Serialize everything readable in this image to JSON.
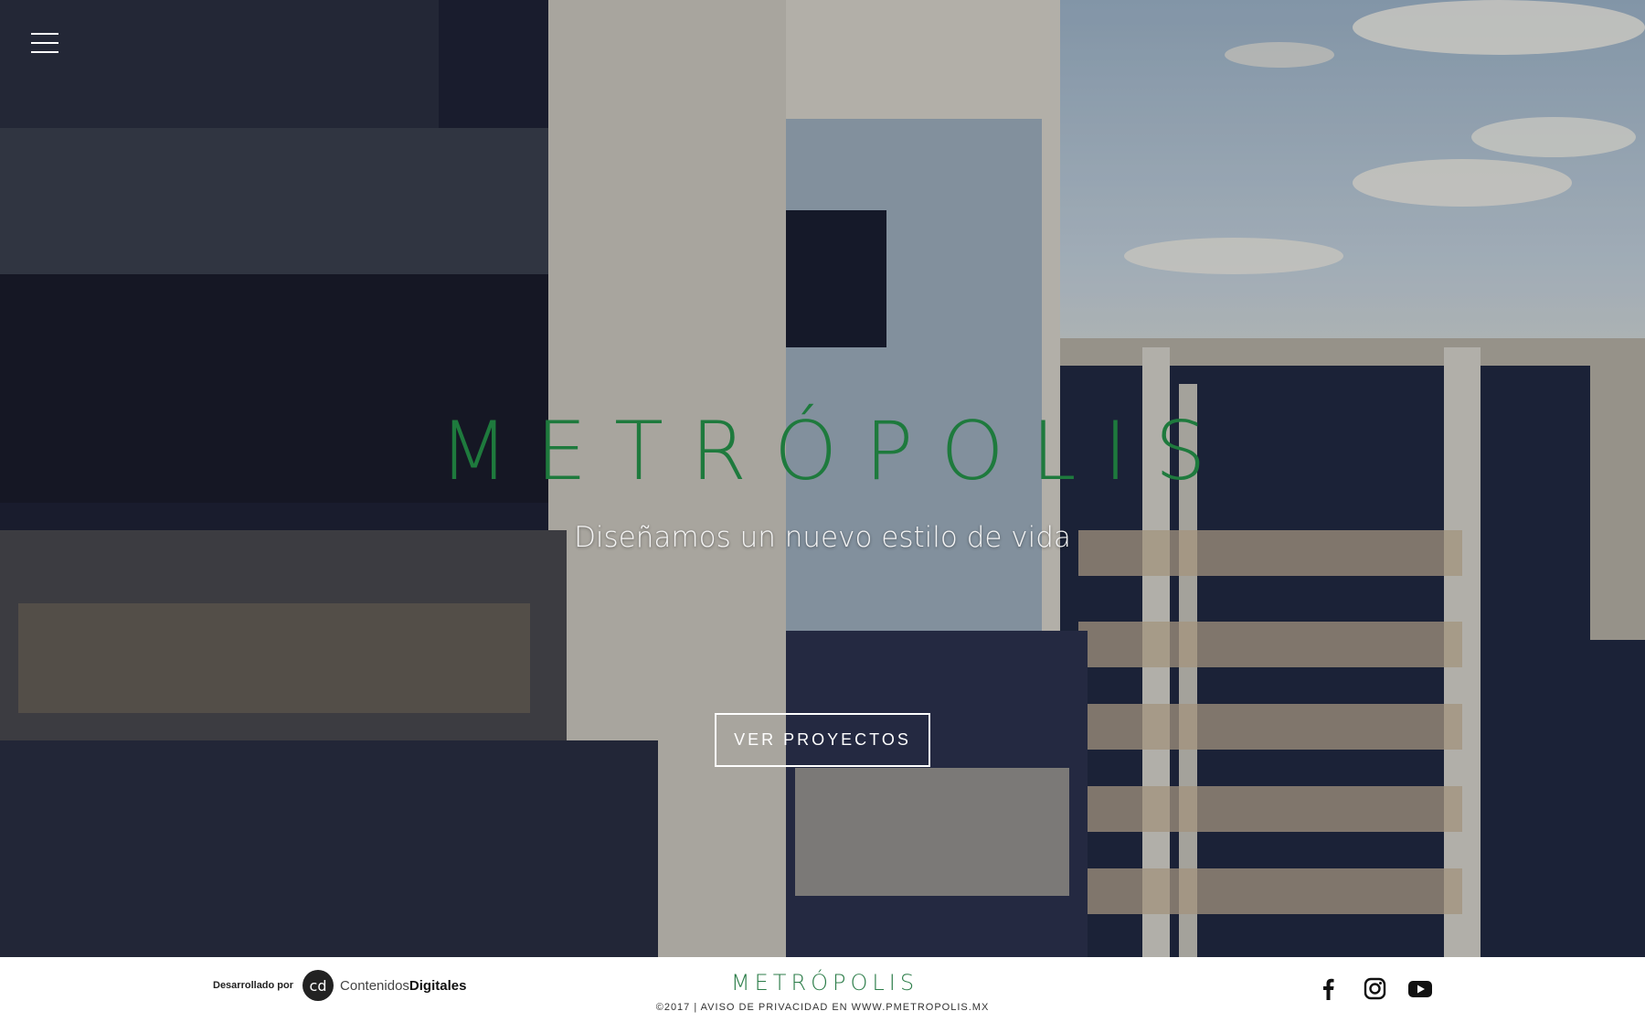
{
  "nav": {
    "menu_icon": "hamburger-menu-icon"
  },
  "hero": {
    "brand": "METRÓPOLIS",
    "tagline": "Diseñamos un nuevo estilo de vida",
    "cta_label": "VER PROYECTOS",
    "brand_color": "#1e7a3d"
  },
  "footer": {
    "developed_by": "Desarrollado por",
    "dev_logo_text": "cd",
    "dev_name_light": "Contenidos",
    "dev_name_bold": "Digitales",
    "brand": "METRÓPOLIS",
    "copyright": "©2017 | AVISO DE PRIVACIDAD EN WWW.PMETROPOLIS.MX",
    "social": [
      {
        "icon": "facebook-icon"
      },
      {
        "icon": "instagram-icon"
      },
      {
        "icon": "youtube-icon"
      }
    ]
  }
}
